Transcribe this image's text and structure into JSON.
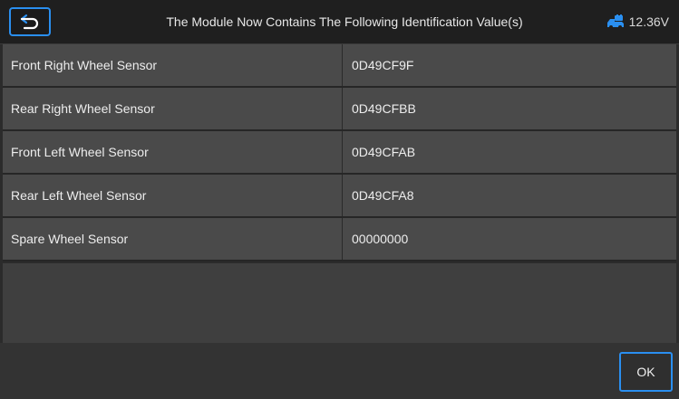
{
  "header": {
    "title": "The Module Now Contains The Following Identification Value(s)",
    "voltage": "12.36V",
    "back_icon": "back-arrow-icon",
    "vehicle_icon": "vehicle-battery-icon"
  },
  "rows": [
    {
      "name": "Front Right Wheel Sensor",
      "value": "0D49CF9F"
    },
    {
      "name": "Rear Right Wheel Sensor",
      "value": "0D49CFBB"
    },
    {
      "name": "Front Left Wheel Sensor",
      "value": "0D49CFAB"
    },
    {
      "name": "Rear Left Wheel Sensor",
      "value": "0D49CFA8"
    },
    {
      "name": "Spare Wheel Sensor",
      "value": "00000000"
    }
  ],
  "footer": {
    "ok_label": "OK"
  },
  "colors": {
    "accent": "#2a8ff0",
    "row_bg": "#4a4a4a",
    "header_bg": "#1f1f1f"
  }
}
